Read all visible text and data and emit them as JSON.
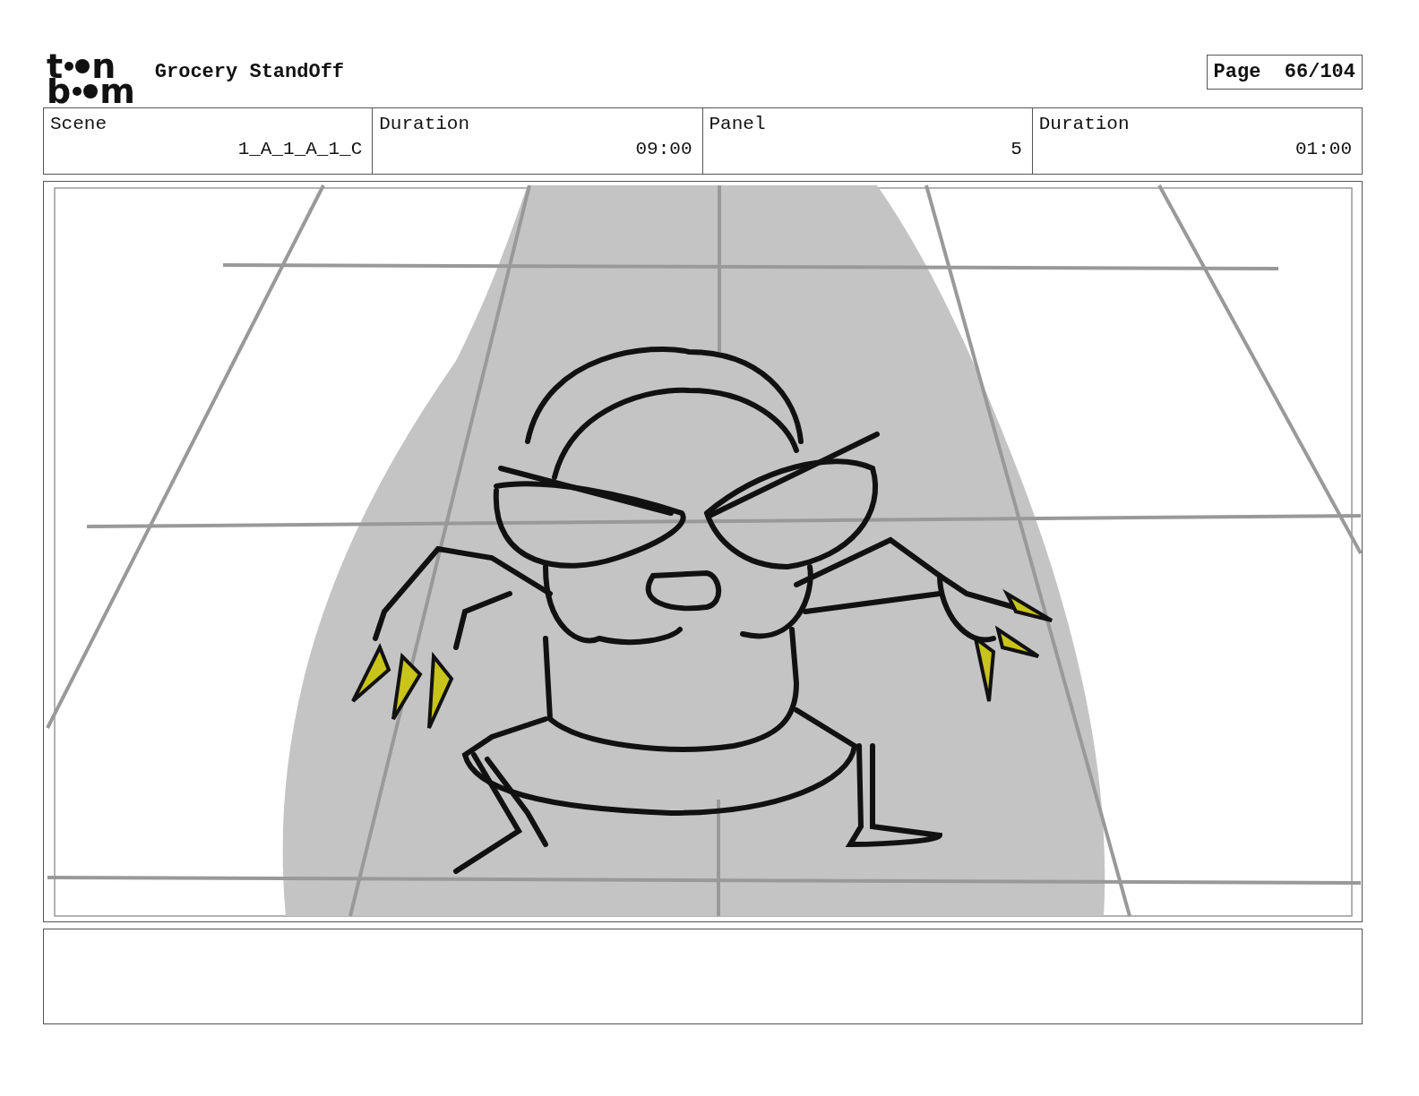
{
  "logo": {
    "lines": [
      [
        "t",
        "n"
      ],
      [
        "b",
        "m"
      ]
    ]
  },
  "project_title": "Grocery StandOff",
  "page": {
    "label": "Page",
    "value": "66/104"
  },
  "fields": [
    {
      "label": "Scene",
      "value": "1_A_1_A_1_C"
    },
    {
      "label": "Duration",
      "value": "09:00"
    },
    {
      "label": "Panel",
      "value": "5"
    },
    {
      "label": "Duration",
      "value": "01:00"
    }
  ]
}
